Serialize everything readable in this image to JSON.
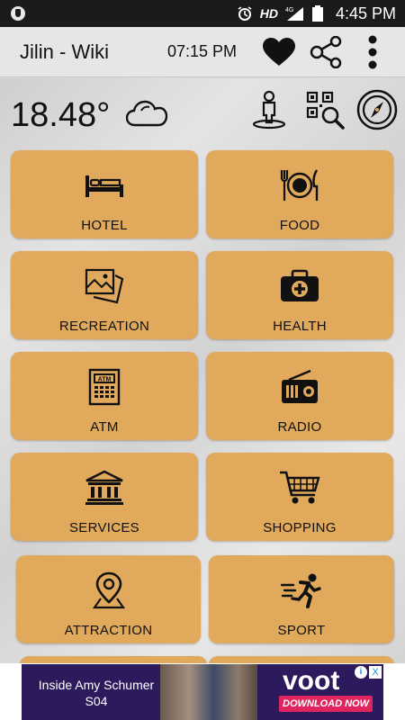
{
  "status_bar": {
    "network": "HD",
    "signal": "4G",
    "time": "4:45 PM"
  },
  "app_bar": {
    "title": "Jilin - Wiki",
    "clock": "07:15 PM"
  },
  "weather": {
    "temperature": "18.48°",
    "condition_icon": "cloud-icon"
  },
  "tiles": [
    {
      "label": "HOTEL",
      "icon": "bed-icon"
    },
    {
      "label": "FOOD",
      "icon": "food-icon"
    },
    {
      "label": "RECREATION",
      "icon": "pictures-icon"
    },
    {
      "label": "HEALTH",
      "icon": "medical-kit-icon"
    },
    {
      "label": "ATM",
      "icon": "atm-icon"
    },
    {
      "label": "RADIO",
      "icon": "radio-icon"
    },
    {
      "label": "SERVICES",
      "icon": "bank-building-icon"
    },
    {
      "label": "SHOPPING",
      "icon": "shopping-cart-icon"
    },
    {
      "label": "ATTRACTION",
      "icon": "map-pin-icon"
    },
    {
      "label": "SPORT",
      "icon": "running-person-icon"
    }
  ],
  "ad": {
    "text": "Inside Amy Schumer S04",
    "brand": "voot",
    "cta": "DOWNLOAD NOW",
    "info_label": "i",
    "close_label": "X"
  },
  "colors": {
    "tile": "#e0a95b",
    "app_bar": "#e6e6e8",
    "status_bar": "#1b1b1b",
    "ad_bg": "#2d1a5c",
    "cta": "#e0245e"
  }
}
